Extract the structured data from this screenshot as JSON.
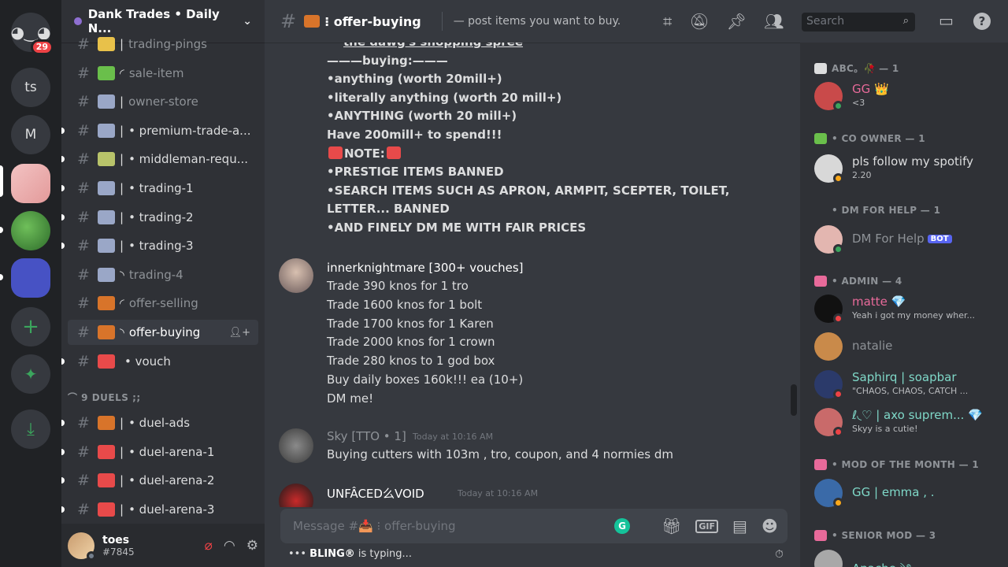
{
  "servers": {
    "home_badge": "29",
    "ts_label": "ts",
    "m_label": "M",
    "add_label": "+",
    "explore_label": "✦",
    "download_label": "⤓"
  },
  "guild": {
    "name": "Dank Trades • Daily N..."
  },
  "channels": [
    {
      "name": "trading-pings",
      "sep": "|",
      "color": "#e8c14a"
    },
    {
      "name": "sale-item",
      "sep": "◜",
      "color": "#6abf4b"
    },
    {
      "name": "owner-store",
      "sep": "|",
      "color": "#9aa7c7"
    },
    {
      "name": "• premium-trade-a...",
      "sep": "|",
      "color": "#9aa7c7"
    },
    {
      "name": "• middleman-requ...",
      "sep": "|",
      "color": "#b8c36a"
    },
    {
      "name": "• trading-1",
      "sep": "|",
      "color": "#9aa7c7"
    },
    {
      "name": "• trading-2",
      "sep": "|",
      "color": "#9aa7c7"
    },
    {
      "name": "• trading-3",
      "sep": "|",
      "color": "#9aa7c7"
    },
    {
      "name": "trading-4",
      "sep": "◝",
      "color": "#9aa7c7"
    },
    {
      "name": "offer-selling",
      "sep": "◜",
      "color": "#d8742a"
    },
    {
      "name": "offer-buying",
      "sep": "◝",
      "color": "#d8742a"
    },
    {
      "name": "• vouch",
      "sep": "",
      "color": "#e84a4a"
    }
  ],
  "category": "⌒ 9 DUELS ;;",
  "duel_channels": [
    {
      "name": "• duel-ads",
      "sep": "|",
      "color": "#d8742a"
    },
    {
      "name": "• duel-arena-1",
      "sep": "|",
      "color": "#e84a4a"
    },
    {
      "name": "• duel-arena-2",
      "sep": "|",
      "color": "#e84a4a"
    },
    {
      "name": "• duel-arena-3",
      "sep": "|",
      "color": "#e84a4a"
    }
  ],
  "user": {
    "name": "toes",
    "tag": "#7845"
  },
  "topbar": {
    "channel": "⁝ offer-buying",
    "topic": "— post items you want to buy.",
    "search_placeholder": "Search"
  },
  "messages": {
    "first_block": [
      {
        "text": "the dawg's shopping spree",
        "style": "bu"
      },
      {
        "text": "———buying:———",
        "style": "b"
      },
      {
        "text": "•anything (worth 20mill+)",
        "style": "b"
      },
      {
        "text": "•literally anything (worth 20 mill+)",
        "style": "b"
      },
      {
        "text": "•ANYTHING (worth 20 mill+)",
        "style": "b"
      },
      {
        "text": "Have 200mill+ to spend!!!",
        "style": "b"
      },
      {
        "text": "NOTE:",
        "style": "b"
      },
      {
        "text": "•PRESTIGE ITEMS BANNED",
        "style": "b"
      },
      {
        "text": "•SEARCH ITEMS SUCH AS APRON, ARMPIT, SCEPTER, TOILET,",
        "style": "b"
      },
      {
        "text": "LETTER... BANNED",
        "style": "b"
      },
      {
        "text": "•AND FINELY DM ME WITH FAIR PRICES",
        "style": "b"
      }
    ],
    "second": {
      "author": "innerknightmare [300+ vouches]",
      "lines": [
        "Trade 390 knos for 1 tro",
        "Trade 1600 knos for 1 bolt",
        "Trade 1700 knos for 1 Karen",
        "Trade 2000 knos for 1 crown",
        "Trade 280 knos to 1 god box",
        "Buy daily boxes 160k!!! ea (10+)",
        "DM me!"
      ]
    },
    "third": {
      "author": "Sky [TTO • 1]",
      "stamp": "Today at 10:16 AM",
      "text": "Buying cutters with 103m , tro, coupon, and 4 normies dm"
    },
    "fourth": {
      "author": "UNFÂCED么VOID",
      "stamp": "Today at 10:16 AM"
    }
  },
  "composer": {
    "placeholder": "Message #📥 ⁝ offer-buying",
    "gif": "GIF"
  },
  "typing": {
    "who": "BLING®",
    "rest": "is typing..."
  },
  "members": {
    "groups": [
      {
        "header": "ABC。🥀 — 1",
        "icon_color": "#dcddde"
      },
      {
        "header": "• CO OWNER — 1",
        "icon_color": "#6abf4b"
      },
      {
        "header": "• DM FOR HELP — 1",
        "icon_color": ""
      },
      {
        "header": "• ADMIN — 4",
        "icon_color": "#e86a9a"
      },
      {
        "header": "• MOD OF THE MONTH — 1",
        "icon_color": "#e86a9a"
      },
      {
        "header": "• SENIOR MOD — 3",
        "icon_color": "#e86a9a"
      }
    ],
    "list": [
      {
        "name": "GG 👑",
        "sub": "<3",
        "color": "#e86a9a",
        "av": "#c94a4a",
        "st": "#3ba55d"
      },
      {
        "name": "pls follow my spotify",
        "sub": "2.20",
        "color": "#dcddde",
        "av": "#d8d8d8",
        "st": "#faa81a"
      },
      {
        "name": "DM For Help",
        "sub": "",
        "bot": "BOT",
        "color": "#8e9297",
        "av": "#e3b6b0",
        "st": "#3ba55d"
      },
      {
        "name": "matte 💎",
        "sub": "Yeah i got my money wher...",
        "color": "#e86a9a",
        "av": "#111111",
        "st": "#ed4245"
      },
      {
        "name": "natalie",
        "sub": "",
        "color": "#8e9297",
        "av": "#c98a4a",
        "st": ""
      },
      {
        "name": "Saphirq | soapbar",
        "sub": "\"CHAOS, CHAOS, CATCH ...",
        "color": "#7fd8c8",
        "av": "#2b3a6a",
        "st": "#ed4245"
      },
      {
        "name": "ℓ◟♡ | axo suprem... 💎",
        "sub": "Skyy is a cutie!",
        "color": "#7fd8c8",
        "av": "#c96a6a",
        "st": "#ed4245"
      },
      {
        "name": "GG | emma , .",
        "sub": "",
        "color": "#7fd8c8",
        "av": "#3a6aa8",
        "st": "#faa81a"
      },
      {
        "name": "Apache ༄",
        "sub": "",
        "color": "#7fd8c8",
        "av": "#a8a8a8",
        "st": ""
      }
    ]
  },
  "colors": {
    "accent": "#5865f2",
    "online": "#3ba55d",
    "dnd": "#ed4245",
    "idle": "#faa81a"
  }
}
